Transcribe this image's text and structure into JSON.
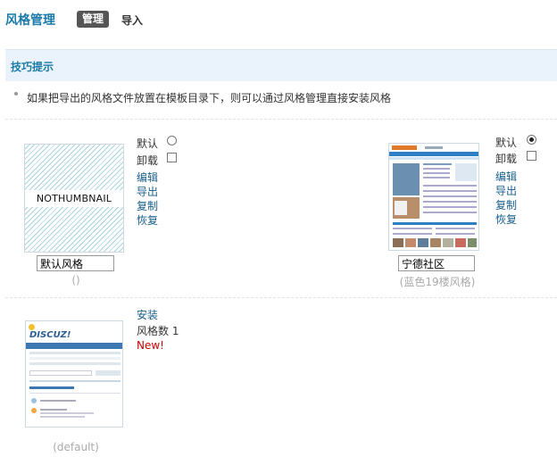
{
  "header": {
    "title": "风格管理",
    "tabs": [
      {
        "label": "管理",
        "active": true
      },
      {
        "label": "导入",
        "active": false
      }
    ]
  },
  "tips": {
    "heading": "技巧提示",
    "text": "如果把导出的风格文件放置在模板目录下，则可以通过风格管理直接安装风格"
  },
  "styles": [
    {
      "thumbnail_text": "NOTHUMBNAIL",
      "name": "默认风格",
      "meta": "()",
      "default_label": "默认",
      "is_default": false,
      "uninstall_label": "卸载",
      "actions": [
        "编辑",
        "导出",
        "复制",
        "恢复"
      ]
    },
    {
      "name": "宁德社区",
      "meta": "(蓝色19楼风格)",
      "default_label": "默认",
      "is_default": true,
      "uninstall_label": "卸载",
      "actions": [
        "编辑",
        "导出",
        "复制",
        "恢复"
      ]
    }
  ],
  "installable": {
    "meta": "(default)",
    "install_label": "安装",
    "count_label": "风格数 1",
    "new_badge": "New!",
    "logo_text": "DISCUZ!"
  },
  "colors": {
    "accent": "#1a7aa8",
    "link": "#1a5f8a",
    "tip_bg": "#eaf3fb",
    "new": "#cc0000"
  }
}
